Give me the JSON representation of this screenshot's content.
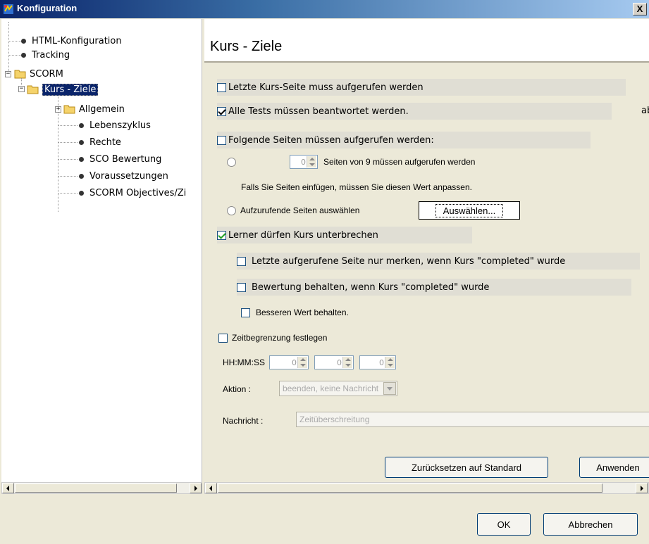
{
  "window": {
    "title": "Konfiguration",
    "close_glyph": "X"
  },
  "tree": {
    "items": [
      {
        "label": "HTML-Konfiguration"
      },
      {
        "label": "Tracking"
      },
      {
        "label": "SCORM"
      },
      {
        "label": "Kurs - Ziele"
      },
      {
        "label": "Allgemein"
      },
      {
        "label": "Lebenszyklus"
      },
      {
        "label": "Rechte"
      },
      {
        "label": "SCO Bewertung"
      },
      {
        "label": "Voraussetzungen"
      },
      {
        "label": "SCORM Objectives/Zi"
      }
    ]
  },
  "panel": {
    "title": "Kurs - Ziele",
    "last_page": {
      "label": "Letzte Kurs-Seite muss aufgerufen werden",
      "checked": false
    },
    "all_tests": {
      "label": "Alle Tests müssen beantwortet werden.",
      "checked": true,
      "trailing": "ab"
    },
    "pages_required": {
      "label": "Folgende Seiten müssen aufgerufen werden:",
      "checked": false
    },
    "count_option": {
      "spinner_value": "0",
      "label": "Seiten von 9 müssen aufgerufen werden"
    },
    "hint": "Falls Sie Seiten einfügen, müssen Sie diesen Wert anpassen.",
    "select_option": {
      "label": "Aufzurufende Seiten auswählen",
      "button": "Auswählen..."
    },
    "interrupt": {
      "label": "Lerner dürfen Kurs unterbrechen",
      "checked": true
    },
    "remember_last": {
      "label": "Letzte aufgerufene Seite nur merken, wenn Kurs \"completed\" wurde",
      "checked": false
    },
    "keep_score": {
      "label": "Bewertung behalten, wenn Kurs \"completed\" wurde",
      "checked": false
    },
    "better_value": {
      "label": "Besseren Wert behalten.",
      "checked": false
    },
    "time_limit": {
      "label": "Zeitbegrenzung festlegen",
      "checked": false
    },
    "time": {
      "label": "HH:MM:SS",
      "hh": "0",
      "mm": "0",
      "ss": "0"
    },
    "action": {
      "label": "Aktion :",
      "value": "beenden, keine Nachricht"
    },
    "message": {
      "label": "Nachricht :",
      "value": "Zeitüberschreitung"
    },
    "reset_button": "Zurücksetzen auf Standard",
    "apply_button": "Anwenden"
  },
  "footer": {
    "ok": "OK",
    "cancel": "Abbrechen"
  }
}
